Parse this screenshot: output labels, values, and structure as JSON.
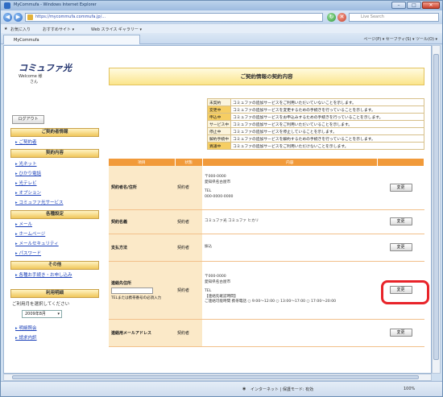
{
  "window": {
    "title": "MyCommufa - Windows Internet Explorer",
    "address": "https://mycommufa.commufa.jp/...",
    "search_placeholder": "Live Search",
    "favorites": [
      "お気に入り",
      "おすすめサイト ▾",
      "Web スライス ギャラリー ▾"
    ],
    "tab_title": "MyCommufa",
    "tools": "ページ(P) ▾  セーフティ(S) ▾  ツール(O) ▾",
    "status_zone": "インターネット | 保護モード: 有効",
    "zoom": "100%"
  },
  "sidebar": {
    "logo": "コミュファ光",
    "welcome_line1": "Welcome 様",
    "welcome_line2": "さん",
    "logout": "ログアウト",
    "sections": [
      {
        "head": "ご契約者情報",
        "links": [
          "ご契約者"
        ]
      },
      {
        "head": "契約内容",
        "links": [
          "光ネット",
          "ひかり電話",
          "光テレビ",
          "オプション",
          "コミュファ光サービス"
        ]
      },
      {
        "head": "各種設定",
        "links": [
          "メール",
          "ホームページ",
          "メールセキュリティ",
          "パスワード"
        ]
      },
      {
        "head": "その他",
        "links": [
          "各種お手続き・お申し込み"
        ]
      },
      {
        "head": "利用明細",
        "links": []
      }
    ],
    "period_text": "ご利用月を選択してください",
    "period_select": "2009年8月",
    "bottom_links": [
      "明細照会",
      "請求内訳"
    ]
  },
  "page_title": "ご契約情報の契約内容",
  "legend": [
    {
      "k": "未契約",
      "v": "コミュファの追加サービスをご利用いただいていないことを示します。"
    },
    {
      "k": "変更中",
      "v": "コミュファの追加サービスを変更するための手続きを行っていることを示します。"
    },
    {
      "k": "申込中",
      "v": "コミュファの追加サービスをお申込みするための手続きを行っていることを示します。"
    },
    {
      "k": "サービス中",
      "v": "コミュファの追加サービスをご利用いただいていることを示します。"
    },
    {
      "k": "停止中",
      "v": "コミュファの追加サービスを停止していることを示します。"
    },
    {
      "k": "解約手続中",
      "v": "コミュファの追加サービスを解約するための手続きを行っていることを示します。"
    },
    {
      "k": "異議中",
      "v": "コミュファの追加サービスをご利用いただけないことを示します。"
    }
  ],
  "table": {
    "headers": [
      "項目",
      "状態",
      "内容",
      ""
    ],
    "rows": [
      {
        "label": "契約者名/住所",
        "status": "契約者",
        "value": [
          "〒000-0000",
          "愛知県名古屋市",
          "",
          "TEL",
          "000-0000-0000"
        ],
        "action": "変更"
      },
      {
        "label": "契約名義",
        "status": "契約者",
        "value": [
          "コミュファ光 コミュファ ヒカリ"
        ],
        "action": "変更"
      },
      {
        "label": "支払方法",
        "status": "契約者",
        "value": [
          "振込"
        ],
        "action": "変更"
      },
      {
        "label": "連絡先住所",
        "status": "契約者",
        "value": [
          "〒000-0000",
          "愛知県名古屋市",
          "",
          "TEL",
          "【連絡先確認時間】",
          "ご連絡可能時間  携帯電話  ○ 9:00〜12:00  ○ 13:00〜17:00  ○ 17:00〜20:00"
        ],
        "action": "変更",
        "extra_note": "TELまたは携帯番号の必須入力"
      },
      {
        "label": "連絡用メールアドレス",
        "status": "契約者",
        "value": [
          ""
        ],
        "action": "変更"
      }
    ]
  }
}
